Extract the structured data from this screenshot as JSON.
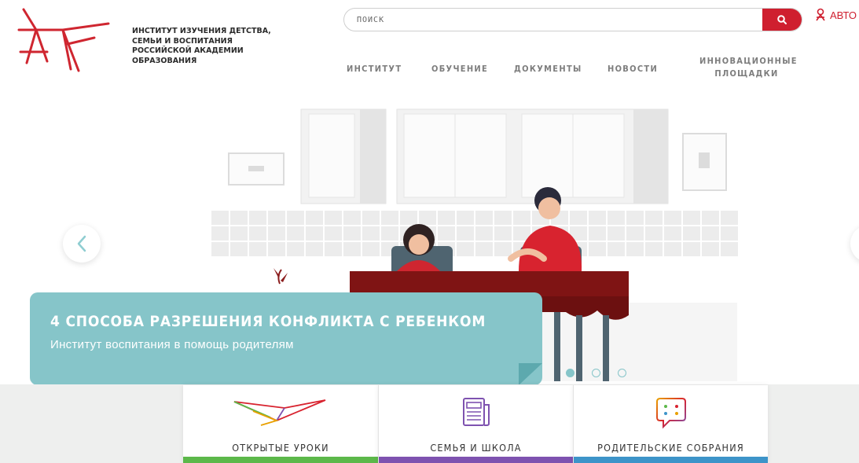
{
  "header": {
    "org_name": "ИНСТИТУТ ИЗУЧЕНИЯ ДЕТСТВА,\nСЕМЬИ И ВОСПИТАНИЯ\nРОССИЙСКОЙ АКАДЕМИИ\nОБРАЗОВАНИЯ",
    "logo_icon": "institute-logo",
    "search": {
      "placeholder": "ПОИСК",
      "icon": "search-icon"
    },
    "auth_label": "АВТО",
    "auth_icon": "user-icon"
  },
  "nav": {
    "items": [
      {
        "label": "ИНСТИТУТ"
      },
      {
        "label": "ОБУЧЕНИЕ"
      },
      {
        "label": "ДОКУМЕНТЫ"
      },
      {
        "label": "НОВОСТИ"
      },
      {
        "label": "ИННОВАЦИОННЫЕ\nПЛОЩАДКИ"
      }
    ]
  },
  "slider": {
    "title": "4 СПОСОБА РАЗРЕШЕНИЯ КОНФЛИКТА С РЕБЕНКОМ",
    "subtitle": "Институт воспитания в помощь родителям",
    "slide_count": 3,
    "active_slide": 1,
    "prev_icon": "chevron-left-icon"
  },
  "cards": [
    {
      "label": "ОТКРЫТЫЕ УРОКИ",
      "icon": "paper-plane-icon",
      "bar_color": "#5cb84a"
    },
    {
      "label": "СЕМЬЯ И ШКОЛА",
      "icon": "newspaper-icon",
      "bar_color": "#7e52b0"
    },
    {
      "label": "РОДИТЕЛЬСКИЕ СОБРАНИЯ",
      "icon": "chat-bubble-icon",
      "bar_color": "#3d94c9"
    }
  ],
  "colors": {
    "brand_red": "#cf1f2f",
    "caption_teal": "#86c5c9",
    "nav_gray": "#7d7d7d"
  }
}
